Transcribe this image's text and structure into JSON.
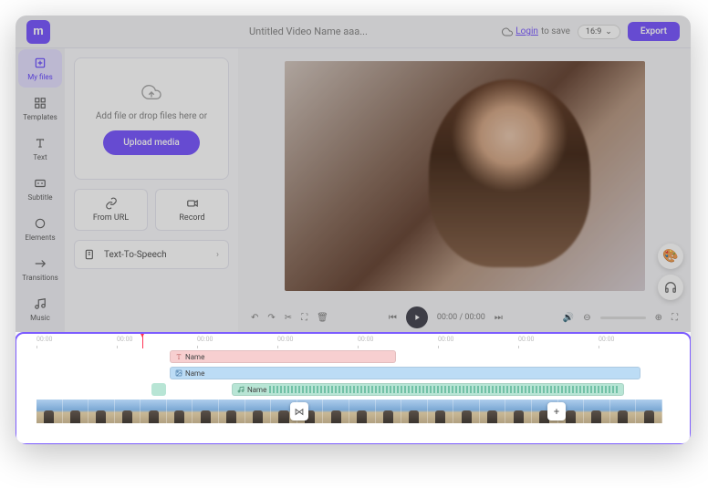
{
  "header": {
    "logo_letter": "m",
    "title": "Untitled Video Name aaa...",
    "login_text": "Login",
    "save_text": "to save",
    "ratio": "16:9",
    "export": "Export"
  },
  "sidebar": [
    {
      "label": "My files",
      "icon": "plus-file"
    },
    {
      "label": "Templates",
      "icon": "grid"
    },
    {
      "label": "Text",
      "icon": "text"
    },
    {
      "label": "Subtitle",
      "icon": "cc"
    },
    {
      "label": "Elements",
      "icon": "shapes"
    },
    {
      "label": "Transitions",
      "icon": "transition"
    },
    {
      "label": "Music",
      "icon": "music"
    }
  ],
  "panel": {
    "drop_text": "Add file or drop files here or",
    "upload_btn": "Upload media",
    "from_url": "From URL",
    "record": "Record",
    "tts": "Text-To-Speech"
  },
  "controls": {
    "time": "00:00 / 00:00"
  },
  "timeline": {
    "ruler_ticks": [
      "00:00",
      "00:00",
      "00:00",
      "00:00",
      "00:00",
      "00:00",
      "00:00",
      "00:00"
    ],
    "clips": {
      "text": "Name",
      "image": "Name",
      "audio": "Name"
    }
  }
}
